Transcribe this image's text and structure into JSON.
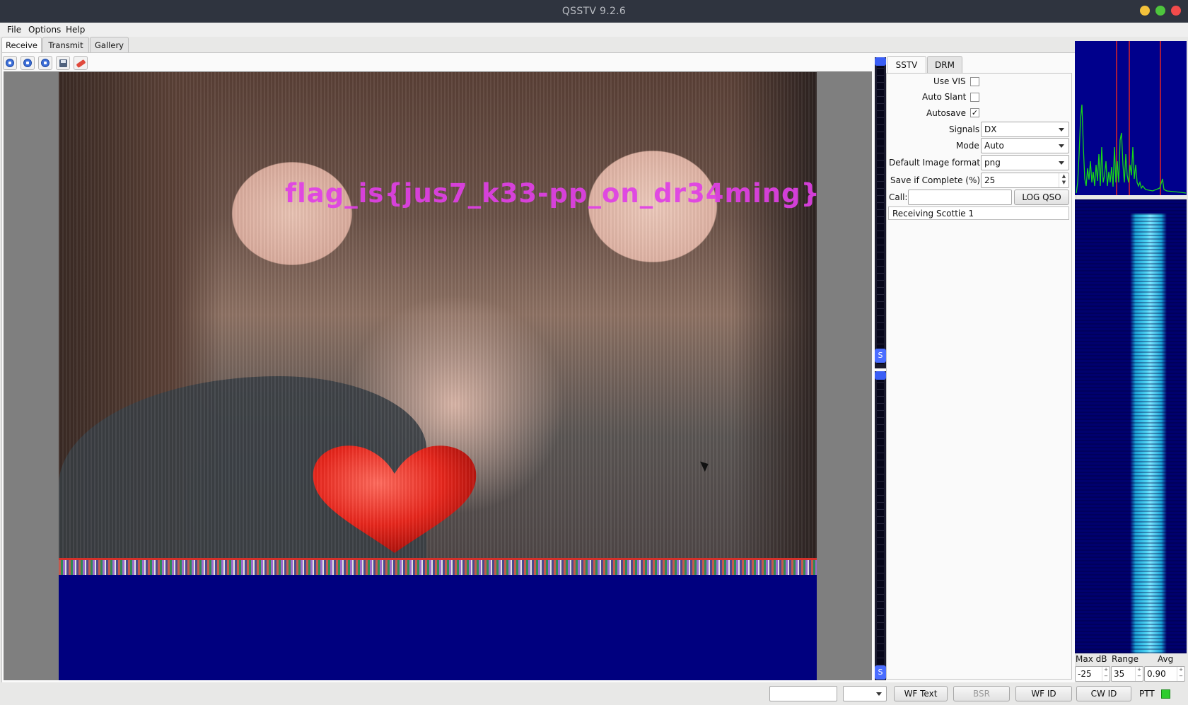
{
  "window": {
    "title": "QSSTV 9.2.6"
  },
  "menu": {
    "file": "File",
    "options": "Options",
    "help": "Help"
  },
  "tabs": {
    "receive": "Receive",
    "transmit": "Transmit",
    "gallery": "Gallery"
  },
  "toolbar": {
    "icons": [
      "start-icon",
      "stop-icon",
      "resync-icon",
      "save-icon",
      "erase-icon"
    ]
  },
  "image": {
    "overlay_text": "flag_is{jus7_k33-pp_on_dr34ming}"
  },
  "subtabs": {
    "sstv": "SSTV",
    "drm": "DRM"
  },
  "settings": {
    "use_vis_label": "Use VIS",
    "use_vis": false,
    "auto_slant_label": "Auto Slant",
    "auto_slant": false,
    "autosave_label": "Autosave",
    "autosave": true,
    "checkmark": "✓",
    "signals_label": "Signals",
    "signals_value": "DX",
    "mode_label": "Mode",
    "mode_value": "Auto",
    "image_format_label": "Default Image format",
    "image_format_value": "png",
    "save_complete_label": "Save if Complete (%)",
    "save_complete_value": "25",
    "call_label": "Call:",
    "call_value": "",
    "log_qso_button": "LOG QSO",
    "status": "Receiving Scottie 1"
  },
  "spectrum": {
    "labels": {
      "max_db": "Max dB",
      "range": "Range",
      "avg": "Avg"
    },
    "max_db_value": "-25",
    "range_value": "35",
    "avg_value": "0.90"
  },
  "bottombar": {
    "combo_value": "",
    "wf_text": "WF Text",
    "bsr": "BSR",
    "wf_id": "WF ID",
    "cw_id": "CW ID",
    "ptt": "PTT"
  },
  "colors": {
    "flag_text": "#e040e6",
    "waterfall_bg": "#00006e",
    "spectrum_bg": "#00008c",
    "ptt_led": "#2ecc2e"
  }
}
